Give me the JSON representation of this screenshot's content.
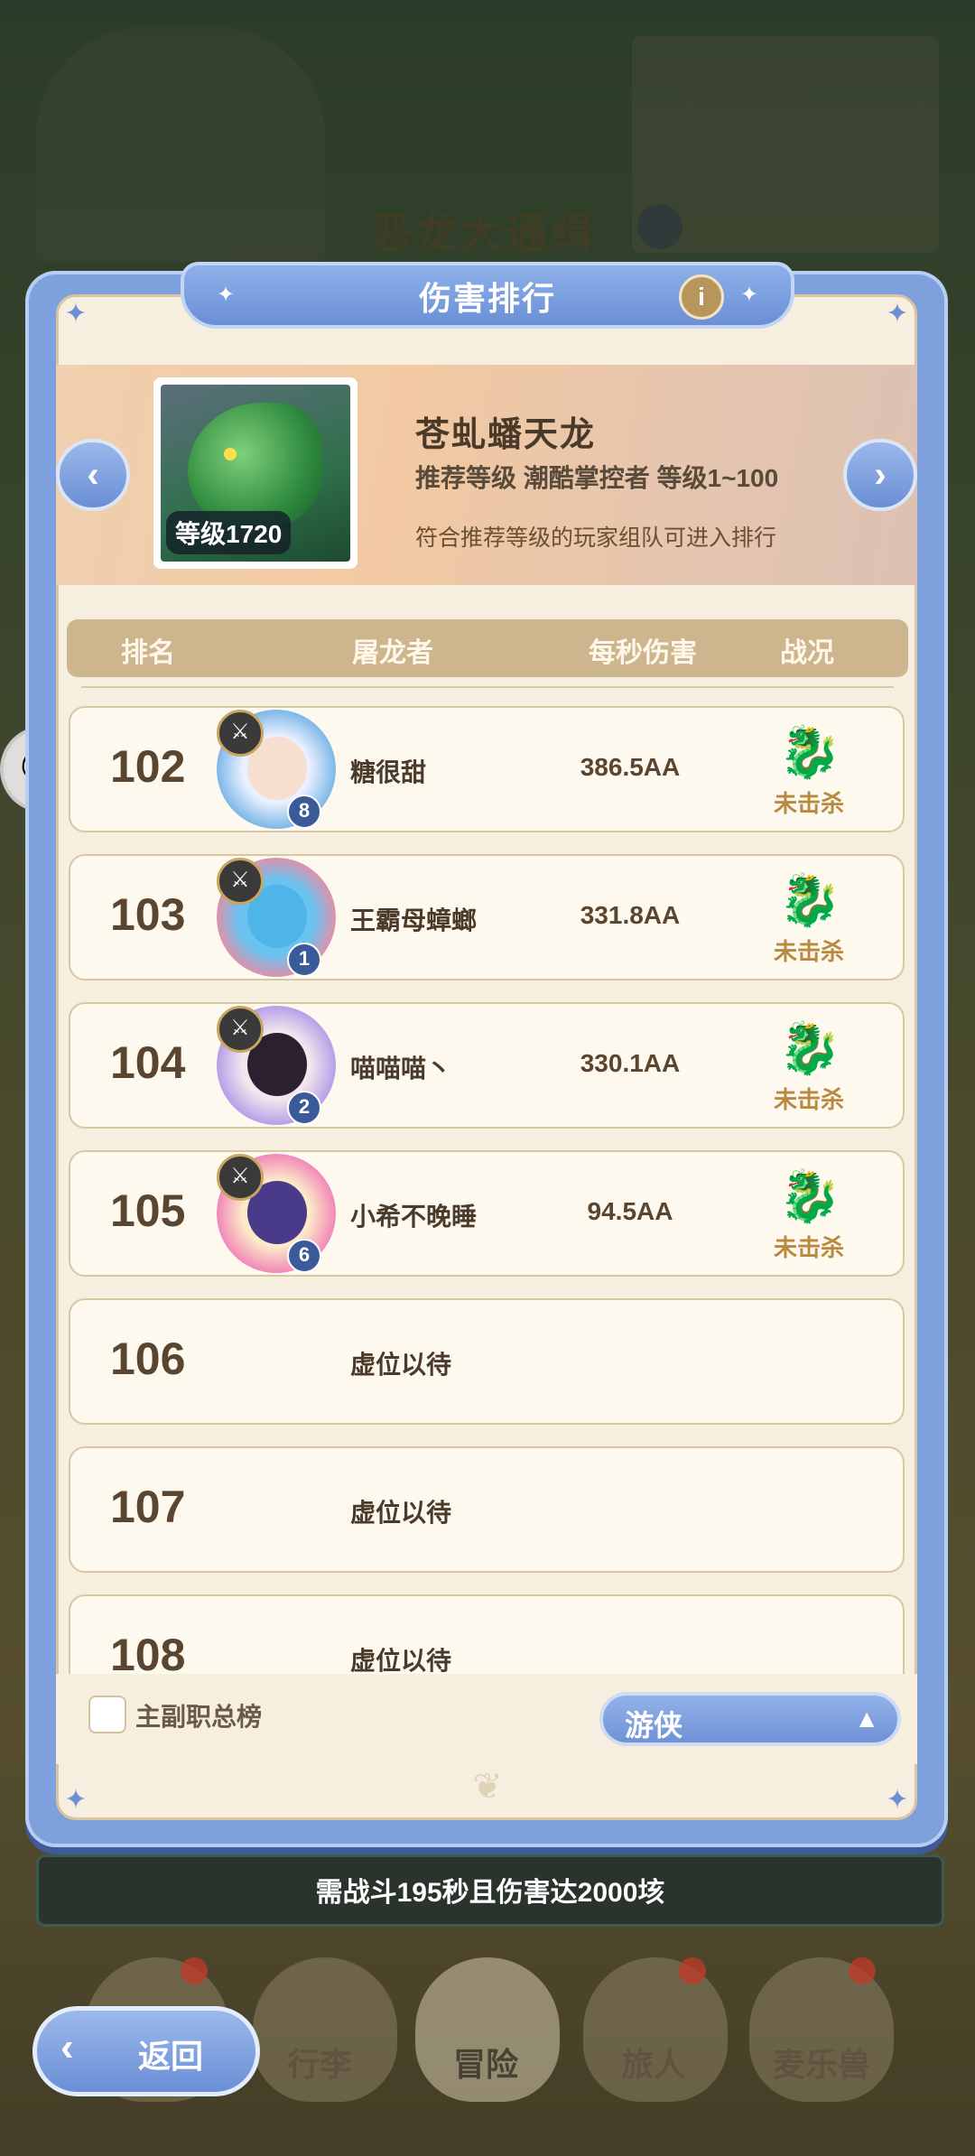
{
  "background": {
    "title": "恶龙大通缉"
  },
  "panel": {
    "title": "伤害排行",
    "info_icon": "i"
  },
  "boss": {
    "name": "苍虬蟠天龙",
    "level": "等级1720",
    "recommend": "推荐等级  潮酷掌控者  等级1~100",
    "note": "符合推荐等级的玩家组队可进入排行"
  },
  "table": {
    "headers": [
      "排名",
      "屠龙者",
      "每秒伤害",
      "战况"
    ],
    "rows": [
      {
        "rank": "102",
        "name": "糖很甜",
        "dps": "386.5AA",
        "status": "未击杀",
        "level": "8"
      },
      {
        "rank": "103",
        "name": "王霸母蟑螂",
        "dps": "331.8AA",
        "status": "未击杀",
        "level": "1"
      },
      {
        "rank": "104",
        "name": "喵喵喵丶",
        "dps": "330.1AA",
        "status": "未击杀",
        "level": "2"
      },
      {
        "rank": "105",
        "name": "小希不晚睡",
        "dps": "94.5AA",
        "status": "未击杀",
        "level": "6"
      },
      {
        "rank": "106",
        "name": "虚位以待",
        "dps": "",
        "status": ""
      },
      {
        "rank": "107",
        "name": "虚位以待",
        "dps": "",
        "status": ""
      },
      {
        "rank": "108",
        "name": "虚位以待",
        "dps": "",
        "status": ""
      }
    ]
  },
  "footer": {
    "checkbox_label": "主副职总榜",
    "class_select": "游侠"
  },
  "requirement": "需战斗195秒且伤害达2000垓",
  "nav": {
    "back": "返回",
    "items": [
      "行李",
      "冒险",
      "旅人",
      "麦乐兽"
    ]
  },
  "colors": {
    "accent": "#6a8fd6",
    "panel_bg": "#f6efe0",
    "header_bg": "#cdb58e"
  }
}
